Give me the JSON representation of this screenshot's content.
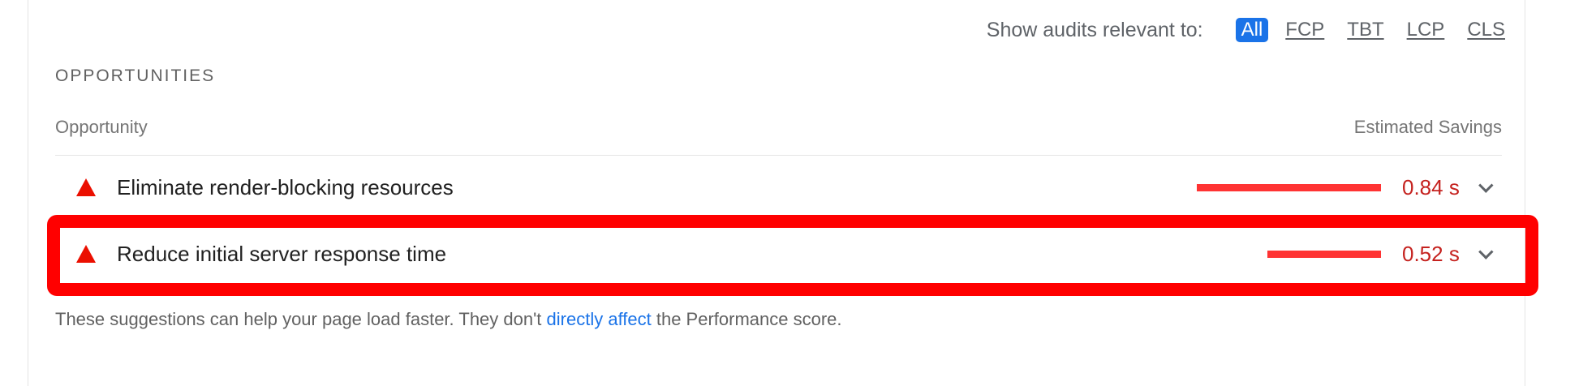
{
  "filter": {
    "label": "Show audits relevant to:",
    "chips": [
      "All",
      "FCP",
      "TBT",
      "LCP",
      "CLS"
    ],
    "active": "All"
  },
  "section": {
    "title": "OPPORTUNITIES",
    "col_opportunity": "Opportunity",
    "col_savings": "Estimated Savings"
  },
  "rows": [
    {
      "title": "Eliminate render-blocking resources",
      "savings": "0.84 s",
      "bar_fraction": 0.84
    },
    {
      "title": "Reduce initial server response time",
      "savings": "0.52 s",
      "bar_fraction": 0.52
    }
  ],
  "footnote": {
    "before": "These suggestions can help your page load faster. They don't ",
    "link": "directly affect",
    "after": " the Performance score."
  },
  "colors": {
    "fail": "#eb0f00",
    "savings_text": "#c5221f",
    "link": "#1a73e8",
    "highlight": "#ff0000"
  }
}
